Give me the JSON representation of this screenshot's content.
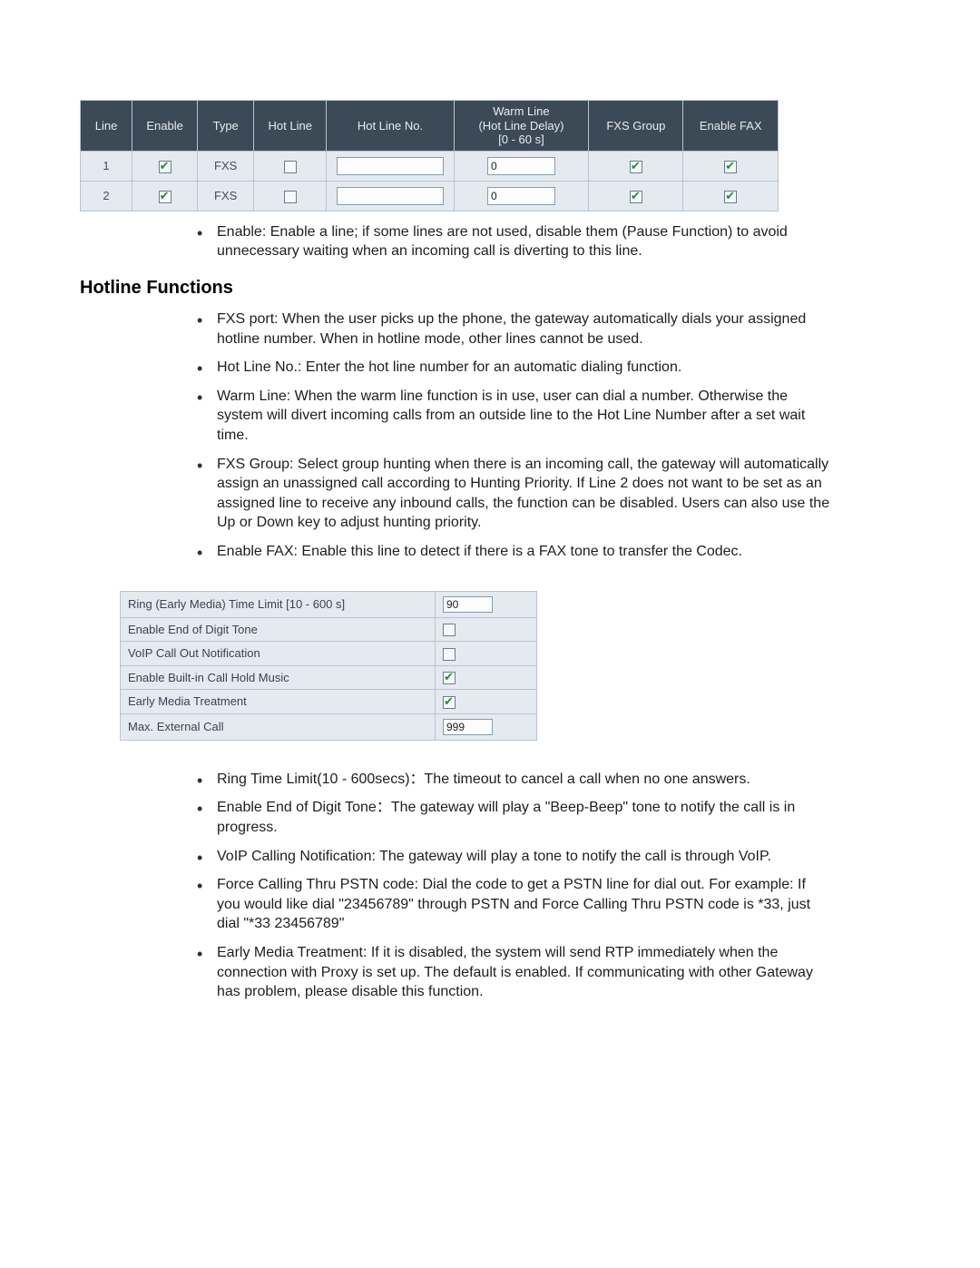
{
  "fxs": {
    "headers": {
      "line": "Line",
      "enable": "Enable",
      "type": "Type",
      "hotline": "Hot Line",
      "hotlineno": "Hot Line No.",
      "warm": "Warm Line\n(Hot Line Delay)\n[0 - 60 s]",
      "group": "FXS Group",
      "fax": "Enable FAX"
    },
    "rows": [
      {
        "line": "1",
        "enable": true,
        "type": "FXS",
        "hotline": false,
        "hotlineno": "",
        "warm": "0",
        "group": true,
        "fax": true
      },
      {
        "line": "2",
        "enable": true,
        "type": "FXS",
        "hotline": false,
        "hotlineno": "",
        "warm": "0",
        "group": true,
        "fax": true
      }
    ]
  },
  "bullets1": [
    "Enable: Enable a line; if some lines are not used, disable them (Pause Function) to avoid unnecessary waiting when an incoming call is diverting to this line."
  ],
  "sectionTitle": "Hotline Functions",
  "bullets2": [
    "FXS port: When the user picks up the phone, the gateway automatically dials your assigned hotline number. When in hotline mode, other lines cannot be used.",
    "Hot Line No.: Enter the hot line number for an automatic dialing function.",
    "Warm Line: When the warm line function is in use, user can dial a number. Otherwise the system will divert incoming calls from an outside line to the Hot Line Number after a set wait time.",
    "FXS Group: Select group hunting when there is an incoming call, the gateway will automatically assign an unassigned call according to Hunting Priority. If Line 2 does not want to be set as an assigned line to receive any inbound calls, the function can be disabled. Users can also use the Up or Down key to adjust hunting priority.",
    "Enable FAX: Enable this line to detect if there is a FAX tone to transfer the Codec."
  ],
  "settings": {
    "rows": [
      {
        "label": "Ring (Early Media) Time Limit [10 - 600 s]",
        "type": "text",
        "value": "90"
      },
      {
        "label": "Enable End of Digit Tone",
        "type": "check",
        "value": false
      },
      {
        "label": "VoIP Call Out Notification",
        "type": "check",
        "value": false
      },
      {
        "label": "Enable Built-in Call Hold Music",
        "type": "check",
        "value": true
      },
      {
        "label": "Early Media Treatment",
        "type": "check",
        "value": true
      },
      {
        "label": "Max. External Call",
        "type": "text",
        "value": "999"
      }
    ]
  },
  "bullets3": [
    "Ring Time Limit(10 - 600secs)：The timeout to cancel a call when no one answers.",
    "Enable End of Digit Tone：The gateway will play a \"Beep-Beep\" tone to notify the call is in progress.",
    "VoIP Calling Notification: The gateway will play a tone to notify the call is through VoIP.",
    "Force Calling Thru PSTN code: Dial the code to get a PSTN line for dial out. For example: If you would like dial \"23456789\" through PSTN and Force Calling Thru PSTN code is *33, just dial \"*33 23456789\"",
    "Early Media Treatment: If it is disabled, the system will send RTP immediately when the connection with Proxy is set up. The default is enabled. If communicating with other Gateway has problem, please disable this function."
  ]
}
